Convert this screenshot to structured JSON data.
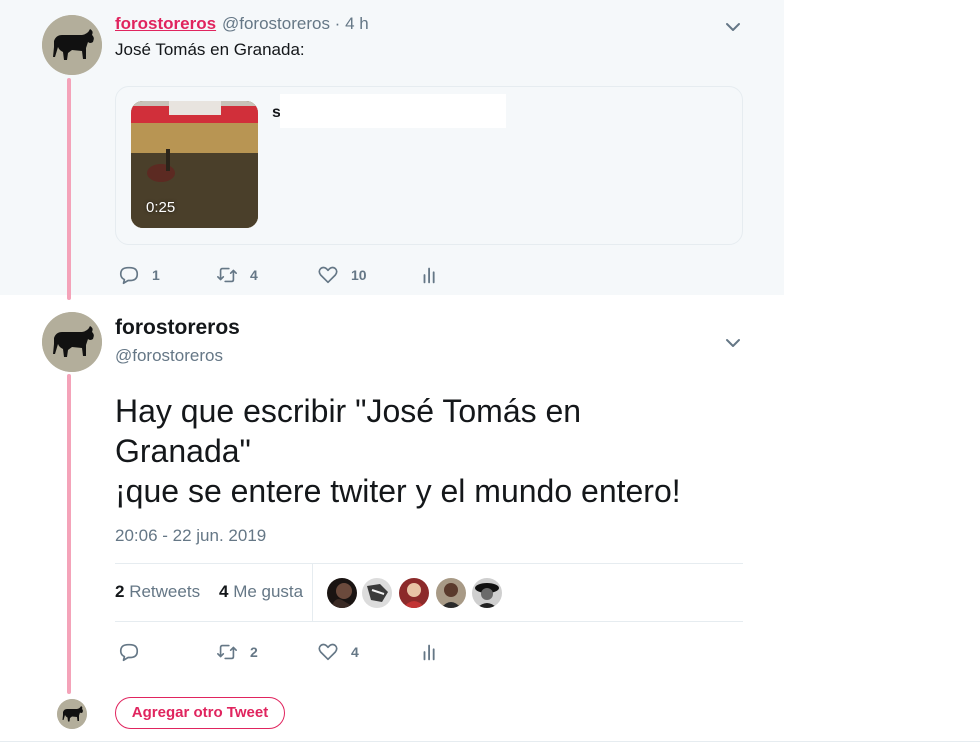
{
  "parent_tweet": {
    "display_name": "forostoreros",
    "handle_time": "@forostoreros · 4 h",
    "text": "José Tomás en Granada:",
    "card": {
      "video_duration": "0:25",
      "title_fragment": "s"
    },
    "actions": {
      "replies": "1",
      "retweets": "4",
      "likes": "10"
    }
  },
  "main_tweet": {
    "display_name": "forostoreros",
    "handle": "@forostoreros",
    "text_lines": [
      "Hay que escribir \"José Tomás en",
      "Granada\"",
      "¡que se entere twiter y el mundo entero!"
    ],
    "timestamp": "20:06 - 22 jun. 2019",
    "stats": {
      "retweets_count": "2",
      "retweets_label": "Retweets",
      "likes_count": "4",
      "likes_label": "Me gusta"
    },
    "liker_avatar_count": 5,
    "actions": {
      "replies": "",
      "retweets": "2",
      "likes": "4"
    }
  },
  "add_tweet_button": "Agregar otro Tweet",
  "icons": {
    "reply": "reply-icon",
    "retweet": "retweet-icon",
    "like": "heart-icon",
    "analytics": "analytics-icon",
    "caret": "chevron-down-icon"
  },
  "colors": {
    "accent": "#e0245e",
    "thread_line": "#f4a3b9",
    "muted_text": "#657786",
    "parent_background": "#f5f8fa"
  }
}
